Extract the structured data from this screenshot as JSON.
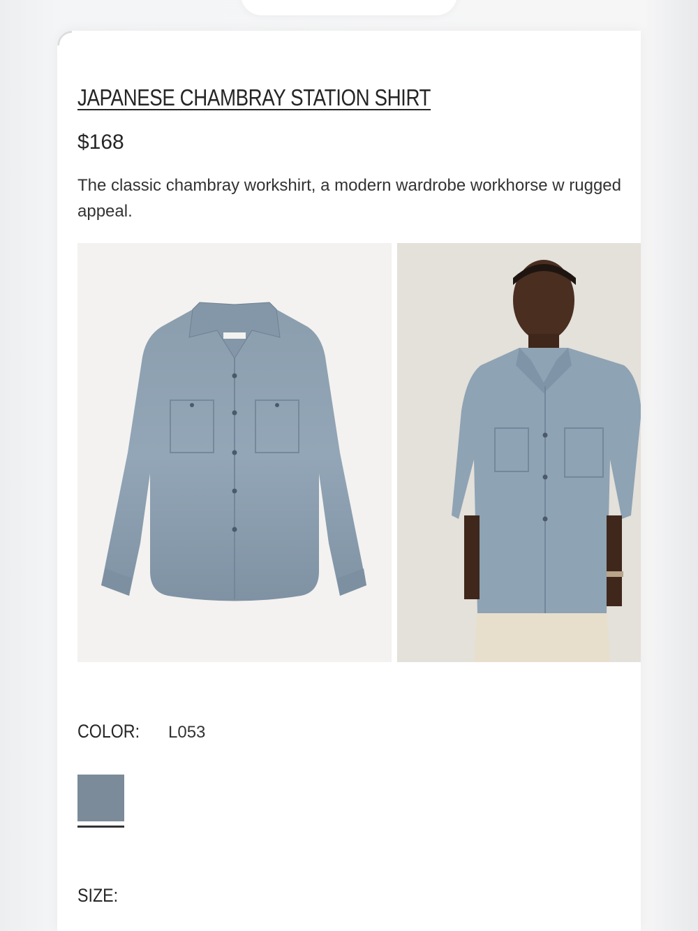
{
  "product": {
    "title": "JAPANESE CHAMBRAY STATION SHIRT",
    "price": "$168",
    "description": "The classic chambray workshirt, a modern wardrobe workhorse w rugged appeal.",
    "images": [
      {
        "name": "flat-lay",
        "icon": "shirt-flat-image"
      },
      {
        "name": "model",
        "icon": "shirt-model-image"
      }
    ]
  },
  "color": {
    "label": "COLOR:",
    "value": "L053",
    "swatch_hex": "#7b8b99"
  },
  "size": {
    "label": "SIZE:"
  }
}
